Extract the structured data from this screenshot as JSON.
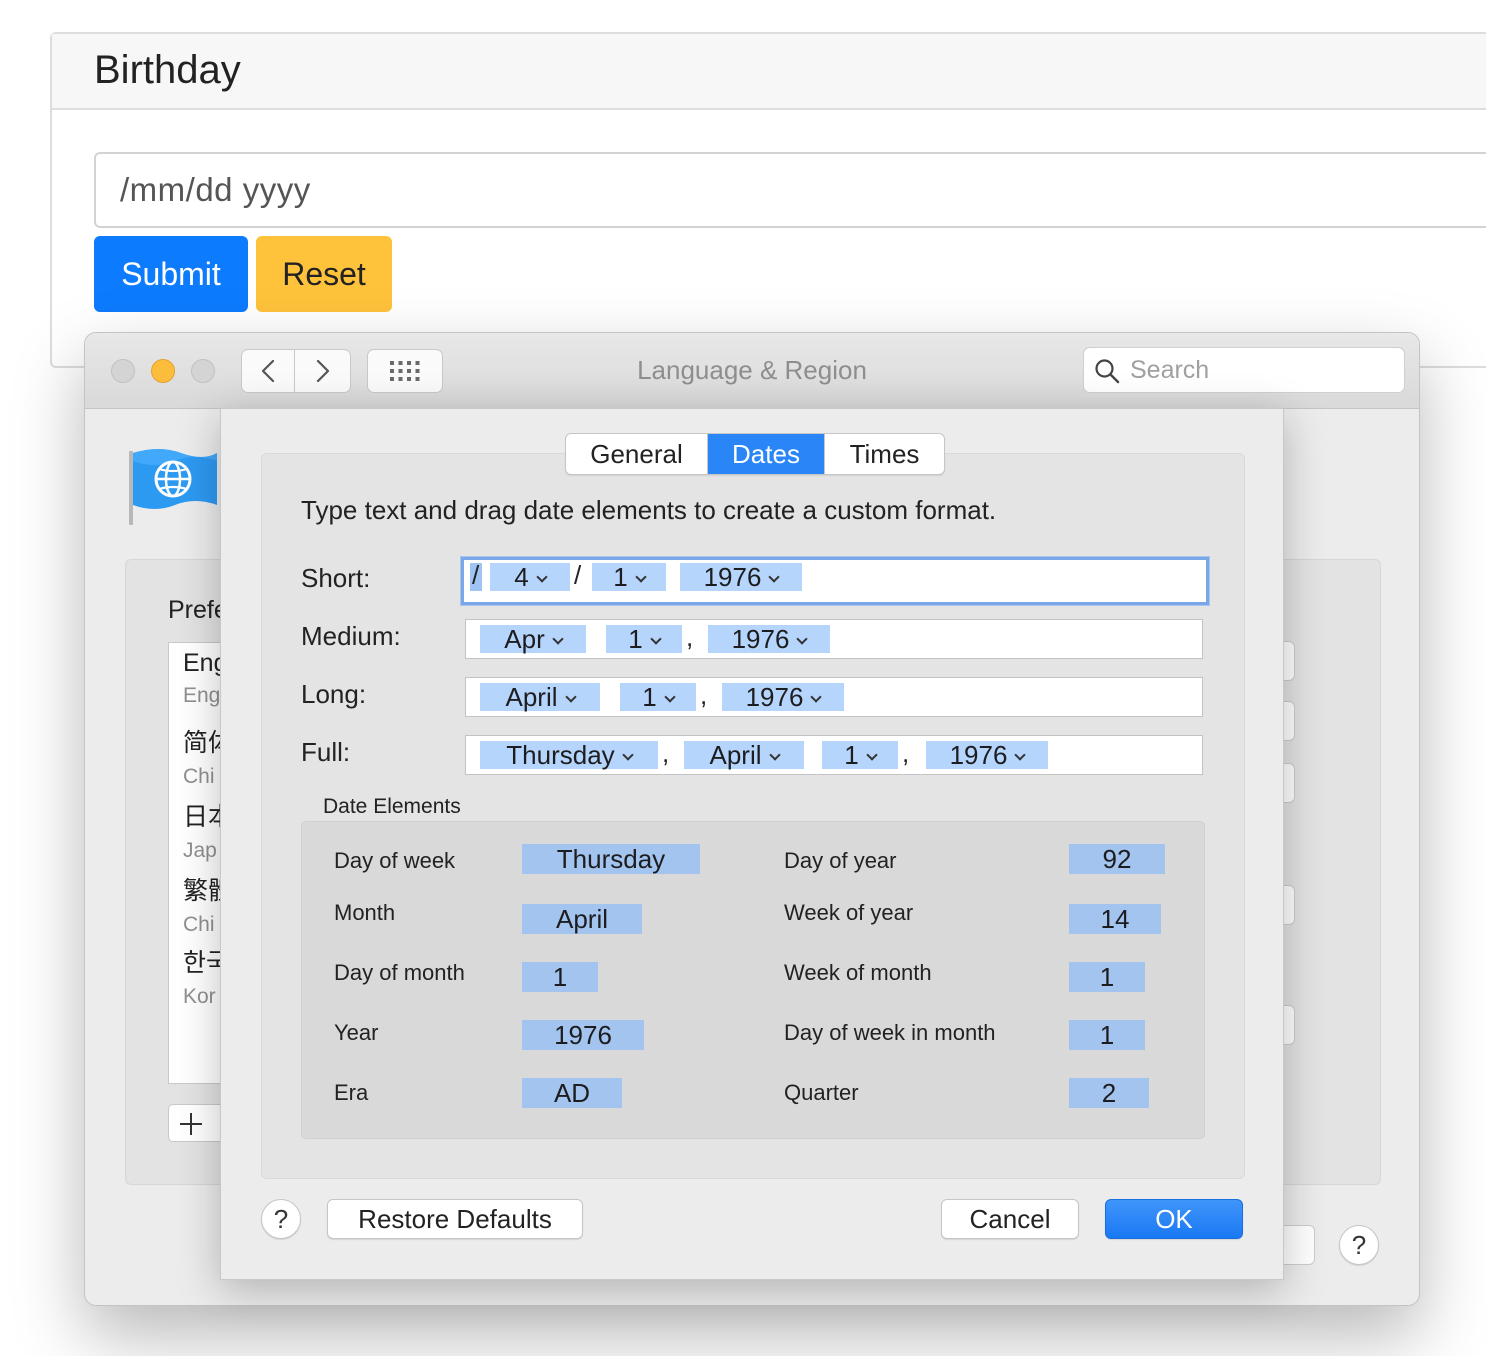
{
  "web": {
    "title": "Birthday",
    "date_value": "/mm/dd yyyy",
    "submit_label": "Submit",
    "reset_label": "Reset",
    "colors": {
      "submit": "#0d7bfe",
      "reset": "#ffc23b"
    }
  },
  "window": {
    "title": "Language & Region",
    "search_placeholder": "Search",
    "preferred_label": "Prefe",
    "languages": [
      {
        "name": "Eng",
        "sub": "Eng"
      },
      {
        "name": "简体",
        "sub": "Chi"
      },
      {
        "name": "日本",
        "sub": "Jap"
      },
      {
        "name": "繁體",
        "sub": "Chi"
      },
      {
        "name": "한국",
        "sub": "Kor"
      }
    ],
    "help_label": "?"
  },
  "sheet": {
    "tabs": {
      "general": "General",
      "dates": "Dates",
      "times": "Times"
    },
    "instruction": "Type text and drag date elements to create a custom format.",
    "formats": {
      "short": {
        "label": "Short:",
        "sep1": "/",
        "sep2": "/",
        "month": "4",
        "day": "1",
        "year": "1976"
      },
      "medium": {
        "label": "Medium:",
        "month": "Apr",
        "day": "1",
        "sep": ",",
        "year": "1976"
      },
      "long": {
        "label": "Long:",
        "month": "April",
        "day": "1",
        "sep": ",",
        "year": "1976"
      },
      "full": {
        "label": "Full:",
        "weekday": "Thursday",
        "sep1": ",",
        "month": "April",
        "day": "1",
        "sep2": ",",
        "year": "1976"
      }
    },
    "elements_title": "Date Elements",
    "elements": {
      "day_of_week": {
        "label": "Day of week",
        "value": "Thursday"
      },
      "month": {
        "label": "Month",
        "value": "April"
      },
      "day_of_month": {
        "label": "Day of month",
        "value": "1"
      },
      "year": {
        "label": "Year",
        "value": "1976"
      },
      "era": {
        "label": "Era",
        "value": "AD"
      },
      "day_of_year": {
        "label": "Day of year",
        "value": "92"
      },
      "week_of_year": {
        "label": "Week of year",
        "value": "14"
      },
      "week_of_month": {
        "label": "Week of month",
        "value": "1"
      },
      "day_of_week_in_month": {
        "label": "Day of week in month",
        "value": "1"
      },
      "quarter": {
        "label": "Quarter",
        "value": "2"
      }
    },
    "buttons": {
      "help": "?",
      "restore": "Restore Defaults",
      "cancel": "Cancel",
      "ok": "OK"
    },
    "colors": {
      "accent": "#2a86f7",
      "token": "#b5d5fc",
      "chip": "#a2c4ee"
    }
  }
}
